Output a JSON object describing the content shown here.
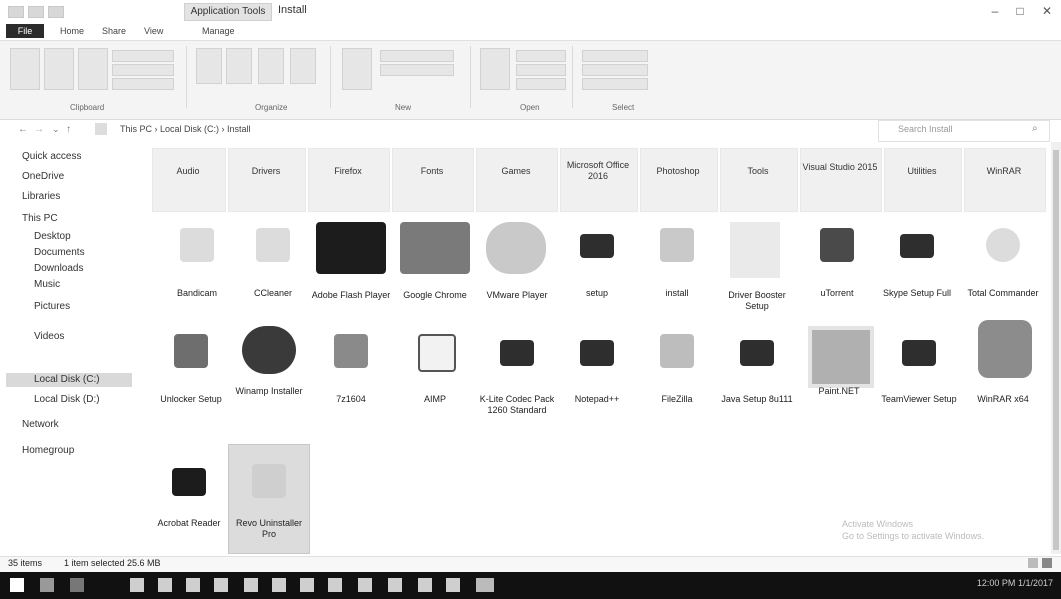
{
  "window": {
    "context_tab": "Application Tools",
    "title": "Install",
    "controls": {
      "minimize": "–",
      "maximize": "□",
      "close": "✕"
    }
  },
  "ribbon": {
    "tabs": [
      "File",
      "Home",
      "Share",
      "View",
      "Manage"
    ],
    "groups": [
      "Clipboard",
      "Organize",
      "New",
      "Open",
      "Select"
    ]
  },
  "address": {
    "path": "This PC › Local Disk (C:) › Install",
    "search_placeholder": "Search Install"
  },
  "nav": {
    "items": [
      "Quick access",
      "OneDrive",
      "Libraries",
      "This PC",
      "Desktop",
      "Documents",
      "Downloads",
      "Music",
      "Pictures",
      "Videos",
      "Local Disk (C:)",
      "Local Disk (D:)",
      "Network",
      "Homegroup"
    ],
    "selected_index": 10
  },
  "folders": [
    "Audio",
    "Drivers",
    "Firefox",
    "Fonts",
    "Games",
    "Microsoft Office 2016",
    "Photoshop",
    "Tools",
    "Visual Studio 2015",
    "Utilities",
    "WinRAR"
  ],
  "items": [
    {
      "name": "Bandicam",
      "icon": "app-icon"
    },
    {
      "name": "CCleaner",
      "icon": "app-icon"
    },
    {
      "name": "Adobe Flash Player",
      "icon": "flash-icon"
    },
    {
      "name": "Google Chrome",
      "icon": "chrome-icon"
    },
    {
      "name": "VMware Player",
      "icon": "setup-icon"
    },
    {
      "name": "setup",
      "icon": "installer-icon"
    },
    {
      "name": "install",
      "icon": "installer-icon"
    },
    {
      "name": "Driver Booster Setup",
      "icon": "document-icon"
    },
    {
      "name": "uTorrent",
      "icon": "app-icon"
    },
    {
      "name": "Skype Setup Full",
      "icon": "installer-icon"
    },
    {
      "name": "Total Commander",
      "icon": "app-icon"
    },
    {
      "name": "Unlocker Setup",
      "icon": "app-icon"
    },
    {
      "name": "Winamp Installer",
      "icon": "setup-icon"
    },
    {
      "name": "7z1604",
      "icon": "archive-icon"
    },
    {
      "name": "AIMP",
      "icon": "app-icon"
    },
    {
      "name": "K-Lite Codec Pack 1260 Standard",
      "icon": "installer-icon"
    },
    {
      "name": "Notepad++",
      "icon": "installer-icon"
    },
    {
      "name": "FileZilla",
      "icon": "app-icon"
    },
    {
      "name": "Java Setup 8u111",
      "icon": "installer-icon"
    },
    {
      "name": "Paint.NET",
      "icon": "image-icon"
    },
    {
      "name": "TeamViewer Setup",
      "icon": "installer-icon"
    },
    {
      "name": "WinRAR x64",
      "icon": "archive-icon"
    },
    {
      "name": "Acrobat Reader",
      "icon": "installer-icon"
    },
    {
      "name": "Revo Uninstaller Pro",
      "icon": "app-icon"
    }
  ],
  "watermark": [
    "Activate Windows",
    "Go to Settings to activate Windows."
  ],
  "status": {
    "count": "35 items",
    "selected": "1 item selected  25.6 MB"
  },
  "taskbar": {
    "clock": "12:00 PM",
    "date": "1/1/2017"
  }
}
